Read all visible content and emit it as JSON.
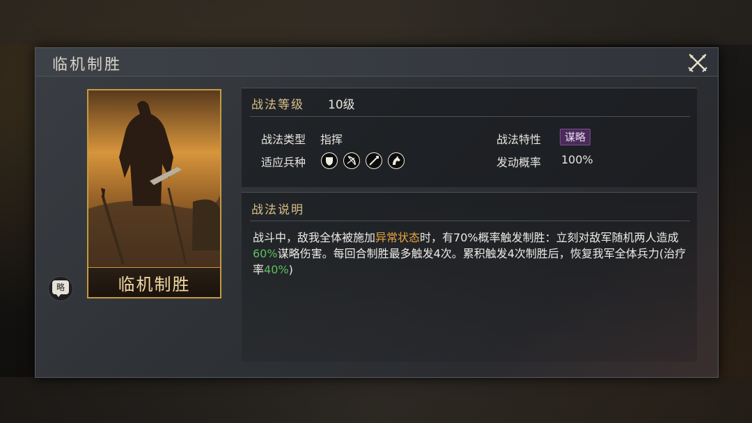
{
  "dialog": {
    "title": "临机制胜",
    "close_icon": "close-crossed-weapons-icon"
  },
  "card": {
    "name": "临机制胜",
    "badge": "略"
  },
  "info": {
    "level_label": "战法等级",
    "level_value": "10级",
    "type_label": "战法类型",
    "type_value": "指挥",
    "trait_label": "战法特性",
    "trait_value": "谋略",
    "units_label": "适应兵种",
    "units": [
      "shield-infantry-icon",
      "bow-archer-icon",
      "spear-icon",
      "cavalry-horse-icon"
    ],
    "rate_label": "发动概率",
    "rate_value": "100%"
  },
  "description": {
    "title": "战法说明",
    "p1": "战斗中，敌我全体被施加",
    "p2": "异常状态",
    "p3": "时，有70%概率触发制胜：立刻对敌军随机两人造成",
    "p4": "60%",
    "p5": "谋略伤害。每回合制胜最多触发4次。累积触发4次制胜后，恢复我军全体兵力(治疗率",
    "p6": "40%",
    "p7": ")"
  },
  "colors": {
    "accent_gold": "#d8c08a",
    "highlight_orange": "#e6a340",
    "highlight_green": "#5cc060",
    "trait_purple": "#4a2b5a"
  }
}
